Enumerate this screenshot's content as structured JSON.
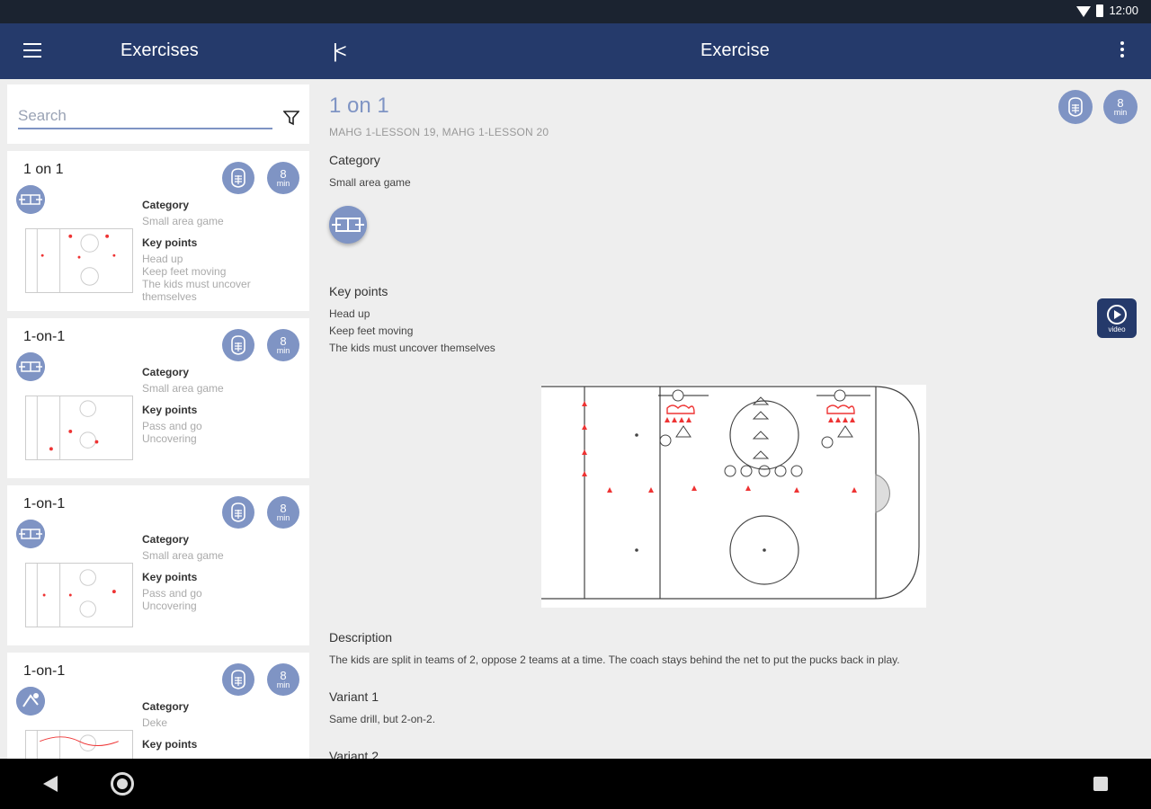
{
  "status_bar": {
    "time": "12:00"
  },
  "app_bar": {
    "left_title": "Exercises",
    "collapse_glyph": "|<",
    "center_title": "Exercise"
  },
  "search": {
    "placeholder": "Search",
    "value": ""
  },
  "list": {
    "items": [
      {
        "title": "1 on 1",
        "category_label": "Category",
        "category": "Small area game",
        "key_points_label": "Key points",
        "key_points": "Head up\nKeep feet moving\nThe kids must uncover\nthemselves",
        "minutes": "8",
        "unit": "min"
      },
      {
        "title": "1-on-1",
        "category_label": "Category",
        "category": "Small area game",
        "key_points_label": "Key points",
        "key_points": "Pass and go\nUncovering",
        "minutes": "8",
        "unit": "min"
      },
      {
        "title": "1-on-1",
        "category_label": "Category",
        "category": "Small area game",
        "key_points_label": "Key points",
        "key_points": "Pass and go\nUncovering",
        "minutes": "8",
        "unit": "min"
      },
      {
        "title": "1-on-1",
        "category_label": "Category",
        "category": "Deke",
        "key_points_label": "Key points",
        "key_points": "",
        "minutes": "8",
        "unit": "min"
      }
    ]
  },
  "detail": {
    "title": "1 on 1",
    "lessons": "MAHG 1-LESSON 19, MAHG 1-LESSON 20",
    "minutes": "8",
    "unit": "min",
    "category_label": "Category",
    "category": "Small area game",
    "key_points_label": "Key points",
    "key_points": "Head up\nKeep feet moving\nThe kids must uncover themselves",
    "video_label": "video",
    "description_label": "Description",
    "description": "The kids are split in teams of 2, oppose 2 teams at a time. The coach stays behind the net to put the pucks back in play.",
    "variant1_label": "Variant 1",
    "variant1": "Same drill, but 2-on-2.",
    "variant2_label": "Variant 2"
  },
  "colors": {
    "app_bar": "#253a6b",
    "accent": "#7f94c4",
    "status_bar": "#1b2330"
  }
}
